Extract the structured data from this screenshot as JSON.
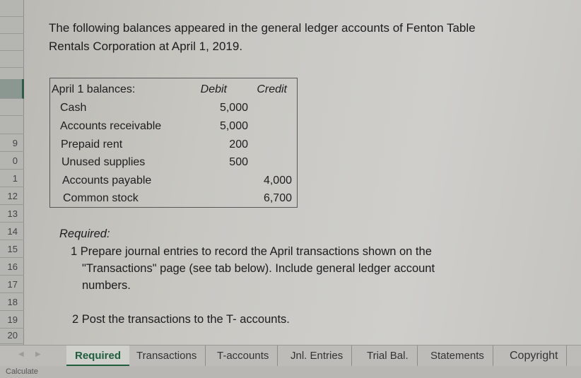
{
  "intro": {
    "line1": "The following balances appeared in the general ledger accounts of Fenton Table",
    "line2": "Rentals Corporation at April 1, 2019."
  },
  "row_headers": [
    "",
    "",
    "",
    "9",
    "0",
    "1",
    "12",
    "13",
    "14",
    "15",
    "16",
    "17",
    "18",
    "19",
    "20"
  ],
  "balances": {
    "title": "April 1 balances:",
    "debit_header": "Debit",
    "credit_header": "Credit",
    "rows": [
      {
        "account": "Cash",
        "debit": "5,000",
        "credit": ""
      },
      {
        "account": "Accounts receivable",
        "debit": "5,000",
        "credit": ""
      },
      {
        "account": "Prepaid rent",
        "debit": "200",
        "credit": ""
      },
      {
        "account": "Unused supplies",
        "debit": "500",
        "credit": ""
      },
      {
        "account": "Accounts payable",
        "debit": "",
        "credit": "4,000"
      },
      {
        "account": "Common stock",
        "debit": "",
        "credit": "6,700"
      }
    ]
  },
  "required": {
    "title": "Required:",
    "item1_line1": "1 Prepare journal entries to record the April transactions shown on the",
    "item1_line2": "\"Transactions\" page (see tab below). Include general ledger account",
    "item1_line3": "numbers.",
    "item2": "2 Post the transactions to the T- accounts."
  },
  "sheet_tabs": {
    "active": "Required",
    "tabs": [
      "Required",
      "Transactions",
      "T-accounts",
      "Jnl. Entries",
      "Trial Bal.",
      "Statements",
      "Copyright"
    ],
    "prev_icon": "◀",
    "next_icon": "▶"
  },
  "status_bar": {
    "text": "Calculate"
  }
}
